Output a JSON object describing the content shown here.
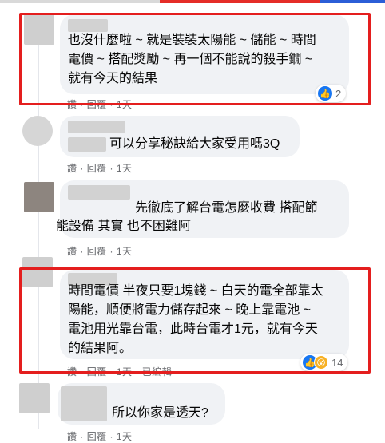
{
  "colors": {
    "highlight": "#e41e1e",
    "bubble": "#f0f2f5",
    "meta_text": "#65676b",
    "like_blue": "#1877f2",
    "wow_yellow": "#f7b125"
  },
  "comments": [
    {
      "lines": [
        "也沒什麼啦 ~ 就是裝裝太陽能 ~ 儲能 ~ 時間",
        "電價 ~ 搭配獎勵 ~ 再一個不能說的殺手鐗 ~",
        "就有今天的結果"
      ],
      "actions": {
        "like": "讚",
        "reply": "回覆",
        "time": "1天"
      },
      "reaction_count": "2",
      "reaction_icons": [
        "like-icon"
      ]
    },
    {
      "lines": [
        "可以分享秘訣給大家受用嗎3Q"
      ],
      "actions": {
        "like": "讚",
        "reply": "回覆",
        "time": "1天"
      }
    },
    {
      "lines": [
        "先徹底了解台電怎麼收費 搭配節",
        "能設備 其實 也不困難阿"
      ],
      "actions": {
        "like": "讚",
        "reply": "回覆",
        "time": "1天"
      }
    },
    {
      "lines": [
        "時間電價 半夜只要1塊錢 ~ 白天的電全部靠太",
        "陽能，順便將電力儲存起來 ~ 晚上靠電池 ~",
        "電池用光靠台電，此時台電才1元，就有今天",
        "的結果阿。"
      ],
      "actions": {
        "like": "讚",
        "reply": "回覆",
        "time": "1天",
        "edited": "已編輯"
      },
      "reaction_count": "14",
      "reaction_icons": [
        "like-icon",
        "wow-icon"
      ]
    },
    {
      "lines": [
        "所以你家是透天?"
      ],
      "actions": {
        "like": "讚",
        "reply": "回覆",
        "time": "1天"
      }
    }
  ]
}
